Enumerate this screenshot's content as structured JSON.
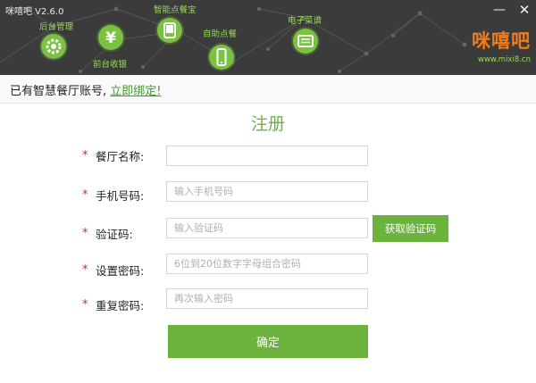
{
  "window": {
    "title": "咪嘻吧 V2.6.0",
    "minimize_label": "—",
    "close_label": "✕"
  },
  "header": {
    "features": [
      {
        "label": "后台管理",
        "icon": "gear-icon"
      },
      {
        "label": "前台收银",
        "icon": "yen-icon"
      },
      {
        "label": "智能点餐宝",
        "icon": "tablet-icon"
      },
      {
        "label": "自助点餐",
        "icon": "phone-icon"
      },
      {
        "label": "电子菜谱",
        "icon": "screen-icon"
      }
    ],
    "brand": {
      "name": "咪嘻吧",
      "url": "www.mixi8.cn"
    },
    "colors": {
      "accent": "#7cc242",
      "brand": "#f07d1c",
      "background": "#3b3b3b"
    }
  },
  "bind": {
    "text": "已有智慧餐厅账号,",
    "link": "立即绑定!"
  },
  "form": {
    "title": "注册",
    "required_mark": "*",
    "fields": [
      {
        "label": "餐厅名称:",
        "placeholder": "",
        "value": ""
      },
      {
        "label": "手机号码:",
        "placeholder": "输入手机号码",
        "value": ""
      },
      {
        "label": "验证码:",
        "placeholder": "输入验证码",
        "value": ""
      },
      {
        "label": "设置密码:",
        "placeholder": "6位到20位数字字母组合密码",
        "value": ""
      },
      {
        "label": "重复密码:",
        "placeholder": "再次输入密码",
        "value": ""
      }
    ],
    "get_code_label": "获取验证码",
    "submit_label": "确定",
    "colors": {
      "button": "#6cb33e",
      "required": "#e3262b",
      "title": "#6cb33e"
    }
  }
}
